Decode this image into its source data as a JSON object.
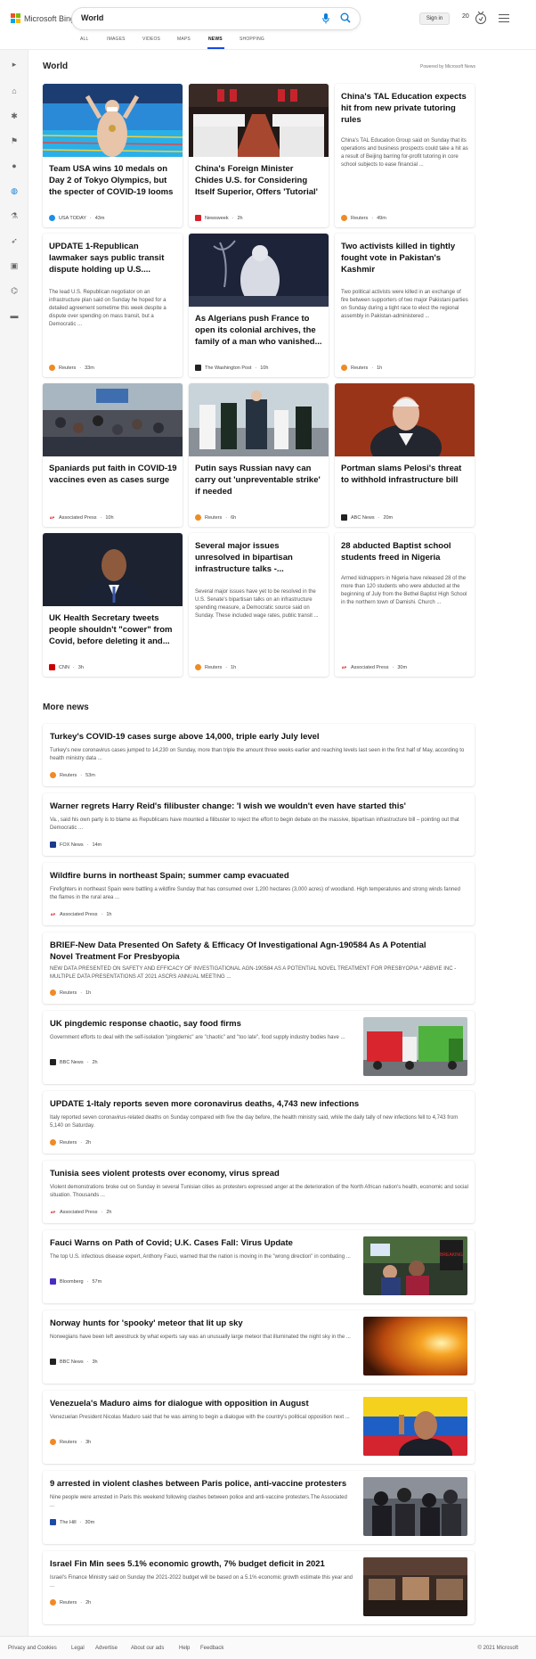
{
  "header": {
    "brand": "Microsoft Bing",
    "search_value": "World",
    "signin": "Sign in",
    "points": "20"
  },
  "tabs": [
    {
      "label": "ALL"
    },
    {
      "label": "IMAGES"
    },
    {
      "label": "VIDEOS"
    },
    {
      "label": "MAPS"
    },
    {
      "label": "NEWS"
    },
    {
      "label": "SHOPPING"
    }
  ],
  "active_tab": "NEWS",
  "section": {
    "title": "World",
    "powered": "Powered by Microsoft News",
    "more_news": "More news"
  },
  "cards": [
    {
      "title": "Team USA wins 10 medals on Day 2 of Tokyo Olympics, but the specter of COVID-19 looms",
      "source": "USA TODAY",
      "time": "43m",
      "snippet": ""
    },
    {
      "title": "China's Foreign Minister Chides U.S. for Considering Itself Superior, Offers 'Tutorial'",
      "source": "Newsweek",
      "time": "2h",
      "snippet": ""
    },
    {
      "title": "China's TAL Education expects hit from new private tutoring rules",
      "source": "Reuters",
      "time": "49m",
      "snippet": "China's TAL Education Group said on Sunday that its operations and business prospects could take a hit as a result of Beijing barring for-profit tutoring in core school subjects to ease financial ..."
    },
    {
      "title": "UPDATE 1-Republican lawmaker says public transit dispute holding up U.S....",
      "source": "Reuters",
      "time": "33m",
      "snippet": "The lead U.S. Republican negotiator on an infrastructure plan said on Sunday he hoped for a detailed agreement sometime this week despite a dispute over spending on mass transit, but a Democratic ..."
    },
    {
      "title": "As Algerians push France to open its colonial archives, the family of a man who vanished...",
      "source": "The Washington Post",
      "time": "10h",
      "snippet": ""
    },
    {
      "title": "Two activists killed in tightly fought vote in Pakistan's Kashmir",
      "source": "Reuters",
      "time": "1h",
      "snippet": "Two political activists were killed in an exchange of fire between supporters of two major Pakistani parties on Sunday during a tight race to elect the regional assembly in Pakistan-administered ..."
    },
    {
      "title": "Spaniards put faith in COVID-19 vaccines even as cases surge",
      "source": "Associated Press",
      "time": "10h",
      "snippet": ""
    },
    {
      "title": "Putin says Russian navy can carry out 'unpreventable strike' if needed",
      "source": "Reuters",
      "time": "6h",
      "snippet": ""
    },
    {
      "title": "Portman slams Pelosi's threat to withhold infrastructure bill",
      "source": "ABC News",
      "time": "20m",
      "snippet": ""
    },
    {
      "title": "UK Health Secretary tweets people shouldn't \"cower\" from Covid, before deleting it and...",
      "source": "CNN",
      "time": "3h",
      "snippet": ""
    },
    {
      "title": "Several major issues unresolved in bipartisan infrastructure talks -...",
      "source": "Reuters",
      "time": "1h",
      "snippet": "Several major issues have yet to be resolved in the U.S. Senate's bipartisan talks on an infrastructure spending measure, a Democratic source said on Sunday. These included wage rates, public transit ..."
    },
    {
      "title": "28 abducted Baptist school students freed in Nigeria",
      "source": "Associated Press",
      "time": "30m",
      "snippet": "Armed kidnappers in Nigeria have released 28 of the more than 120 students who were abducted at the beginning of July from the Bethel Baptist High School in the northern town of Damishi. Church ..."
    }
  ],
  "more_news": [
    {
      "title": "Turkey's COVID-19 cases surge above 14,000, triple early July level",
      "snippet": "Turkey's new coronavirus cases jumped to 14,230 on Sunday, more than triple the amount three weeks earlier and reaching levels last seen in the first half of May, according to health ministry data ...",
      "source": "Reuters",
      "time": "53m"
    },
    {
      "title": "Warner regrets Harry Reid's filibuster change: 'I wish we wouldn't even have started this'",
      "snippet": "Va., said his own party is to blame as Republicans have mounted a filibuster to reject the effort to begin debate on the massive, bipartisan infrastructure bill – pointing out that Democratic ...",
      "source": "FOX News",
      "time": "14m"
    },
    {
      "title": "Wildfire burns in northeast Spain; summer camp evacuated",
      "snippet": "Firefighters in northeast Spain were battling a wildfire Sunday that has consumed over 1,200 hectares (3,000 acres) of woodland. High temperatures and strong winds fanned the flames in the rural area ...",
      "source": "Associated Press",
      "time": "1h"
    },
    {
      "title": "BRIEF-New Data Presented On Safety & Efficacy Of Investigational Agn-190584 As A Potential Novel Treatment For Presbyopia",
      "snippet": "NEW DATA PRESENTED ON SAFETY AND EFFICACY OF INVESTIGATIONAL AGN-190584 AS A POTENTIAL NOVEL TREATMENT FOR PRESBYOPIA * ABBVIE INC - MULTIPLE DATA PRESENTATIONS AT 2021 ASCRS ANNUAL MEETING ...",
      "source": "Reuters",
      "time": "1h"
    },
    {
      "title": "UK pingdemic response chaotic, say food firms",
      "snippet": "Government efforts to deal with the self-isolation \"pingdemic\" are \"chaotic\" and \"too late\", food supply industry bodies have ...",
      "source": "BBC News",
      "time": "2h"
    },
    {
      "title": "UPDATE 1-Italy reports seven more coronavirus deaths, 4,743 new infections",
      "snippet": "Italy reported seven coronavirus-related deaths on Sunday compared with five the day before, the health ministry said, while the daily tally of new infections fell to 4,743 from 5,140 on Saturday.",
      "source": "Reuters",
      "time": "2h"
    },
    {
      "title": "Tunisia sees violent protests over economy, virus spread",
      "snippet": "Violent demonstrations broke out on Sunday in several Tunisian cities as protesters expressed anger at the deterioration of the North African nation's health, economic and social situation. Thousands ...",
      "source": "Associated Press",
      "time": "2h"
    },
    {
      "title": "Fauci Warns on Path of Covid; U.K. Cases Fall: Virus Update",
      "snippet": "The top U.S. infectious disease expert, Anthony Fauci, warned that the nation is moving in the \"wrong direction\" in combating ...",
      "source": "Bloomberg",
      "time": "57m"
    },
    {
      "title": "Norway hunts for 'spooky' meteor that lit up sky",
      "snippet": "Norwegians have been left awestruck by what experts say was an unusually large meteor that illuminated the night sky in the ...",
      "source": "BBC News",
      "time": "3h"
    },
    {
      "title": "Venezuela's Maduro aims for dialogue with opposition in August",
      "snippet": "Venezuelan President Nicolas Maduro said that he was aiming to begin a dialogue with the country's political opposition next ...",
      "source": "Reuters",
      "time": "3h"
    },
    {
      "title": "9 arrested in violent clashes between Paris police, anti-vaccine protesters",
      "snippet": "Nine people were arrested in Paris this weekend following clashes between police and anti-vaccine protesters.The Associated ...",
      "source": "The Hill",
      "time": "30m"
    },
    {
      "title": "Israel Fin Min sees 5.1% economic growth, 7% budget deficit in 2021",
      "snippet": "Israel's Finance Ministry said on Sunday the 2021-2022 budget will be based on a 5.1% economic growth estimate this year and ...",
      "source": "Reuters",
      "time": "2h"
    }
  ],
  "thumb_protest_sign": "BREAKING",
  "footer": {
    "links": [
      "Privacy and Cookies",
      "Legal",
      "Advertise",
      "About our ads",
      "Help",
      "Feedback"
    ],
    "copyright": "© 2021 Microsoft"
  }
}
